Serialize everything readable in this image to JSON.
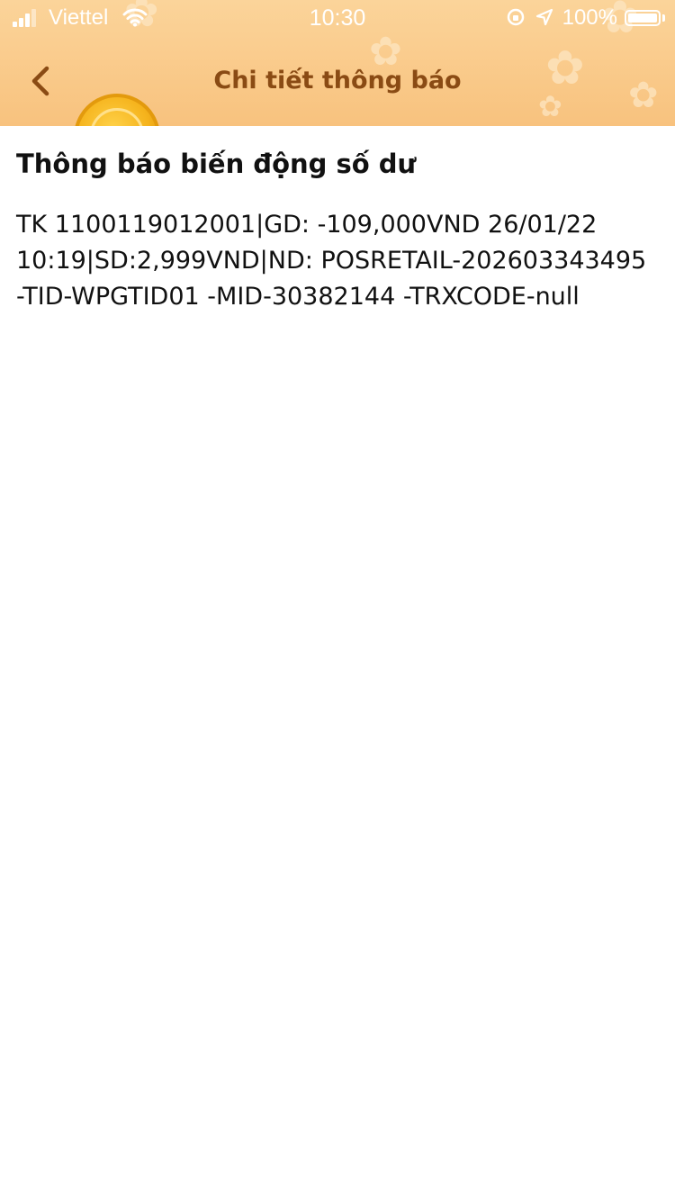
{
  "status_bar": {
    "carrier": "Viettel",
    "time": "10:30",
    "battery_percent": "100%"
  },
  "nav": {
    "title": "Chi tiết thông báo",
    "back_icon": "chevron-left-icon"
  },
  "notification": {
    "title": "Thông báo biến động số dư",
    "body_lines": [
      "TK 1100119012001|GD: -109,000VND 26/01/22",
      "10:19|SD:2,999VND|ND: POSRETAIL-202603343495",
      "-TID-WPGTID01 -MID-30382144 -TRXCODE-null"
    ]
  },
  "colors": {
    "header_bg": "#f8c27e",
    "title_text": "#8a4b14",
    "body_text": "#111111"
  }
}
